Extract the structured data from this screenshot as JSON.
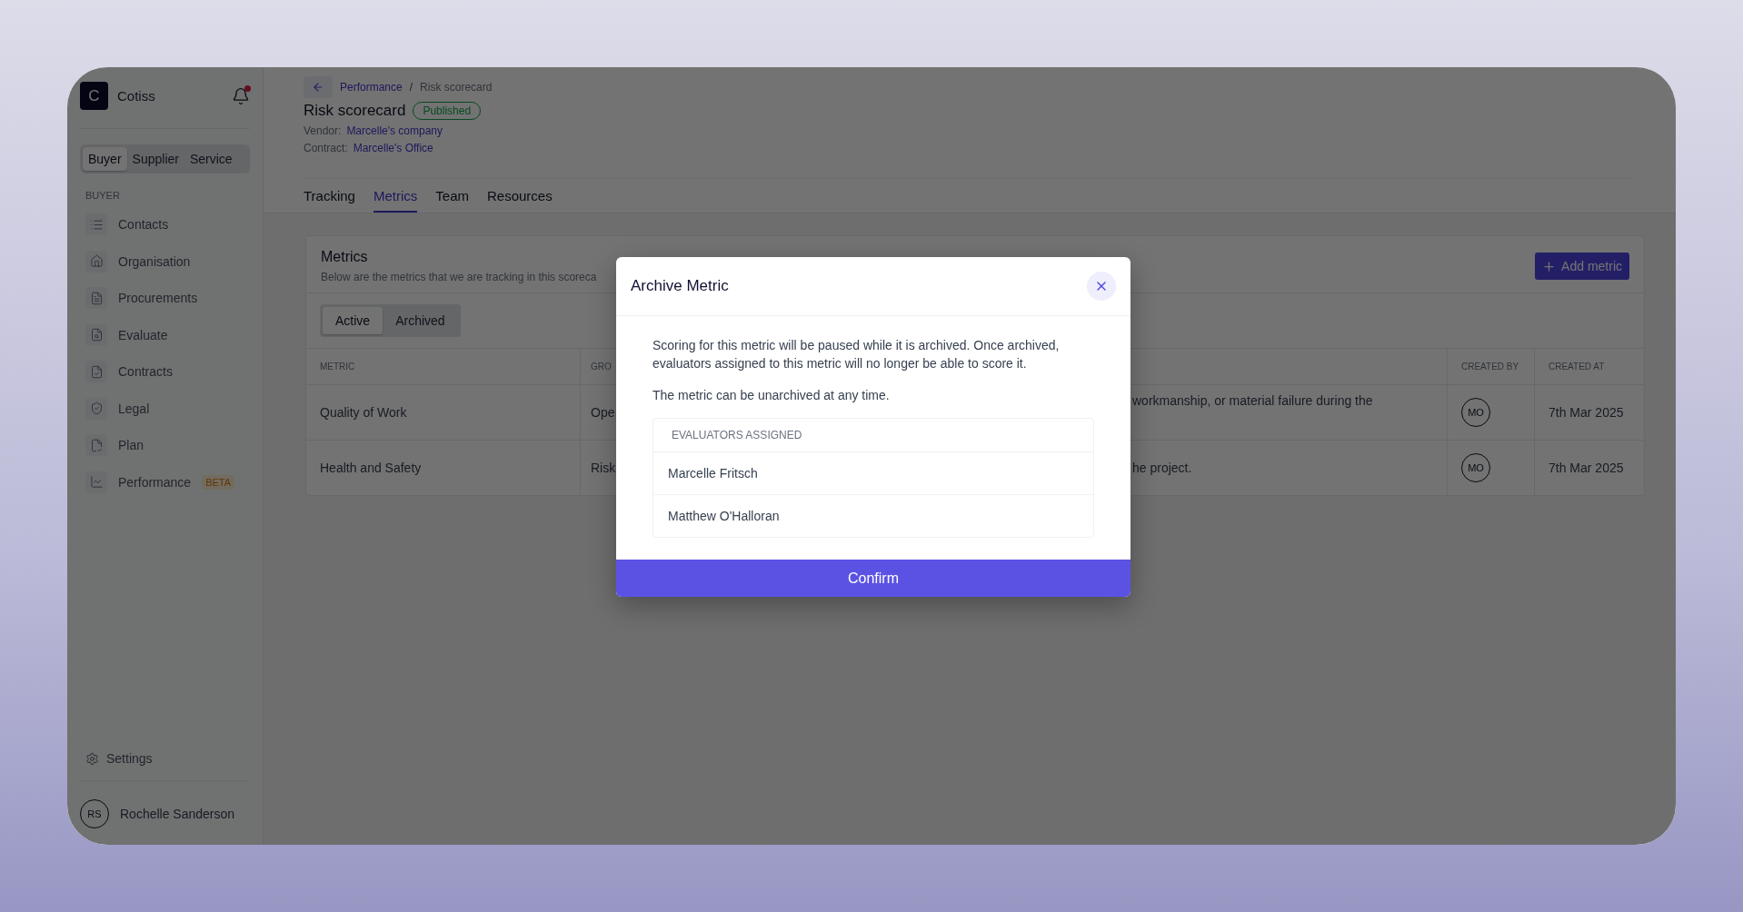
{
  "app": {
    "logo_letter": "C",
    "name": "Cotiss",
    "notifications_unread": true
  },
  "mode_switch": [
    {
      "label": "Buyer",
      "selected": true
    },
    {
      "label": "Supplier",
      "selected": false
    },
    {
      "label": "Service",
      "selected": false
    }
  ],
  "sidebar": {
    "section": "BUYER",
    "items": [
      {
        "label": "Contacts"
      },
      {
        "label": "Organisation"
      },
      {
        "label": "Procurements"
      },
      {
        "label": "Evaluate"
      },
      {
        "label": "Contracts"
      },
      {
        "label": "Legal"
      },
      {
        "label": "Plan"
      },
      {
        "label": "Performance",
        "badge": "BETA"
      }
    ],
    "settings": "Settings"
  },
  "user": {
    "initials": "RS",
    "name": "Rochelle Sanderson"
  },
  "breadcrumb": {
    "items": [
      "Performance",
      "Risk scorecard"
    ],
    "separator": "/"
  },
  "page": {
    "title": "Risk scorecard",
    "status": "Published",
    "vendor_label": "Vendor:",
    "vendor": "Marcelle's company",
    "contract_label": "Contract:",
    "contract": "Marcelle's Office"
  },
  "tabs": [
    {
      "label": "Tracking",
      "selected": false
    },
    {
      "label": "Metrics",
      "selected": true
    },
    {
      "label": "Team",
      "selected": false
    },
    {
      "label": "Resources",
      "selected": false
    }
  ],
  "metrics": {
    "title": "Metrics",
    "subtitle": "Below are the metrics that we are tracking in this scoreca",
    "add_button": "Add metric",
    "filter": [
      {
        "label": "Active",
        "selected": true
      },
      {
        "label": "Archived",
        "selected": false
      }
    ],
    "table": {
      "columns": [
        "METRIC",
        "GRO",
        "CREATED BY",
        "CREATED AT"
      ],
      "rows": [
        {
          "metric": "Quality of Work",
          "group": "Ope",
          "description": "workmanship, or material failure during the",
          "created_by": "MO",
          "created_at": "7th Mar 2025"
        },
        {
          "metric": "Health and Safety",
          "group": "Risk",
          "description": "he project.",
          "created_by": "MO",
          "created_at": "7th Mar 2025"
        }
      ]
    }
  },
  "modal": {
    "title": "Archive Metric",
    "paragraphs": [
      "Scoring for this metric will be paused while it is archived. Once archived, evaluators assigned to this metric will no longer be able to score it.",
      "The metric can be unarchived at any time."
    ],
    "evaluators_heading": "EVALUATORS ASSIGNED",
    "evaluators": [
      "Marcelle Fritsch",
      "Matthew O'Halloran"
    ],
    "confirm": "Confirm"
  }
}
